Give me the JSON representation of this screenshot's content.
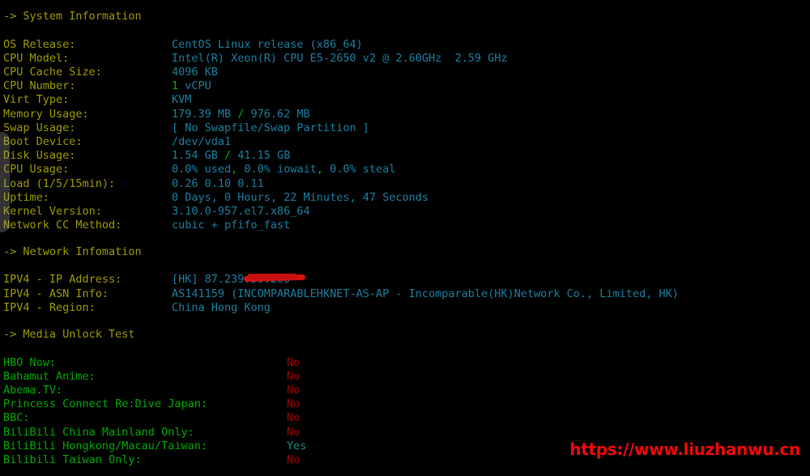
{
  "colors": {
    "background": "#000000",
    "header": "#999900",
    "label": "#999900",
    "value": "#1b7d9e",
    "accent_green": "#00b400",
    "media_label": "#00a800",
    "no": "#a00000",
    "yes": "#1a8c7c",
    "watermark": "#f50505",
    "redaction": "#d81212"
  },
  "sections": {
    "system": {
      "header": "-> System Information",
      "rows": [
        {
          "label": "OS Release:",
          "value": "CentOS Linux release (x86_64)"
        },
        {
          "label": "CPU Model:",
          "value": "Intel(R) Xeon(R) CPU E5-2650 v2 @ 2.60GHz  2.59 GHz"
        },
        {
          "label": "CPU Cache Size:",
          "value": "4096 KB"
        },
        {
          "label": "CPU Number:",
          "value_pre": "1",
          "value": " vCPU",
          "accent": "pre"
        },
        {
          "label": "Virt Type:",
          "value": "KVM"
        },
        {
          "label": "Memory Usage:",
          "value_a": "179.39 MB",
          "sep": " / ",
          "value_b": "976.62 MB",
          "accent": "sep"
        },
        {
          "label": "Swap Usage:",
          "value": "[ No Swapfile/Swap Partition ]"
        },
        {
          "label": "Boot Device:",
          "value": "/dev/vda1"
        },
        {
          "label": "Disk Usage:",
          "value_a": "1.54 GB",
          "sep": " / ",
          "value_b": "41.15 GB",
          "accent": "sep"
        },
        {
          "label": "CPU Usage:",
          "value_a": "0.0% used",
          "sep1": ",",
          "value_b": " 0.0% iowait",
          "sep2": ",",
          "value_c": " 0.0% steal",
          "accent": "commas"
        },
        {
          "label": "Load (1/5/15min):",
          "value": "0.26 0.10 0.11"
        },
        {
          "label": "Uptime:",
          "value": "0 Days, 0 Hours, 22 Minutes, 47 Seconds"
        },
        {
          "label": "Kernel Version:",
          "value": "3.10.0-957.el7.x86_64"
        },
        {
          "label": "Network CC Method:",
          "value": "cubic + pfifo_fast"
        }
      ]
    },
    "network": {
      "header": "-> Network Infomation",
      "rows": [
        {
          "label": "IPV4 - IP Address:",
          "value": "[HK] 87.239.50.200"
        },
        {
          "label": "IPV4 - ASN Info:",
          "value": "AS141159 (INCOMPARABLEHKNET-AS-AP - Incomparable(HK)Network Co., Limited, HK)"
        },
        {
          "label": "IPV4 - Region:",
          "value": "China Hong Kong"
        }
      ]
    },
    "media": {
      "header": "-> Media Unlock Test",
      "rows": [
        {
          "label": "HBO Now:",
          "result": "No"
        },
        {
          "label": "Bahamut Anime:",
          "result": "No"
        },
        {
          "label": "Abema.TV:",
          "result": "No"
        },
        {
          "label": "Princess Connect Re:Dive Japan:",
          "result": "No"
        },
        {
          "label": "BBC:",
          "result": "No"
        },
        {
          "label": "BiliBili China Mainland Only:",
          "result": "No"
        },
        {
          "label": "BiliBili Hongkong/Macau/Taiwan:",
          "result": "Yes"
        },
        {
          "label": "Bilibili Taiwan Only:",
          "result": "No"
        }
      ]
    }
  },
  "watermark": {
    "text": "https://www.liuzhanwu.cn"
  }
}
